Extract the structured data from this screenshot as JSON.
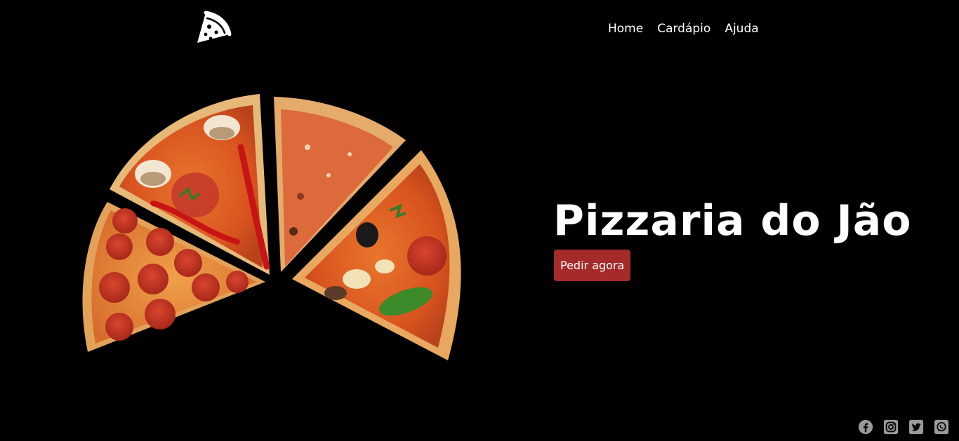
{
  "header": {
    "logo_icon": "pizza-slice-icon",
    "nav": [
      {
        "label": "Home"
      },
      {
        "label": "Cardápio"
      },
      {
        "label": "Ajuda"
      }
    ]
  },
  "hero": {
    "image": "pizza-slices-image",
    "title": "Pizzaria do Jão",
    "cta_label": "Pedir agora",
    "cta_color": "#a52a2a"
  },
  "social": [
    {
      "icon": "facebook-icon"
    },
    {
      "icon": "instagram-icon"
    },
    {
      "icon": "twitter-icon"
    },
    {
      "icon": "whatsapp-icon"
    }
  ],
  "colors": {
    "background": "#000000",
    "text": "#ffffff",
    "social_icon": "#9a9a9a"
  }
}
